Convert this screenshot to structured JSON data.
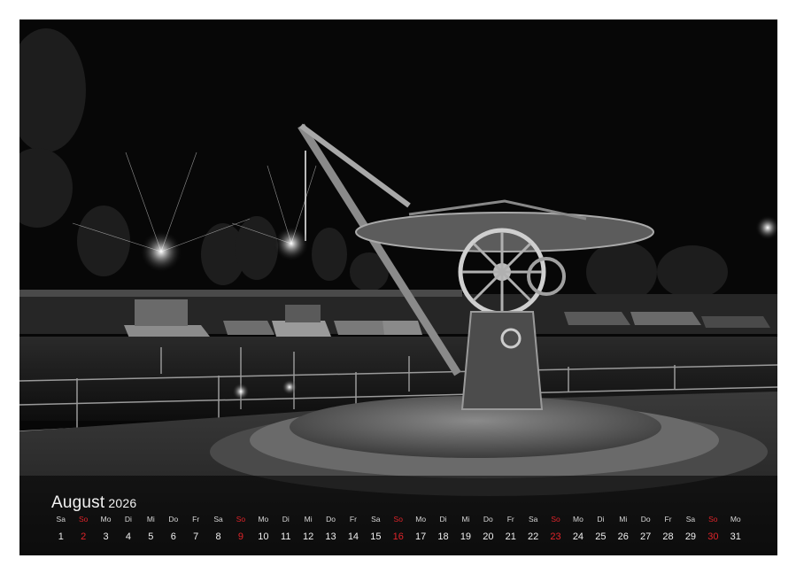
{
  "calendar": {
    "month": "August",
    "year": "2026",
    "days": [
      {
        "dn": "Sa",
        "d": "1",
        "red": false
      },
      {
        "dn": "So",
        "d": "2",
        "red": true
      },
      {
        "dn": "Mo",
        "d": "3",
        "red": false
      },
      {
        "dn": "Di",
        "d": "4",
        "red": false
      },
      {
        "dn": "Mi",
        "d": "5",
        "red": false
      },
      {
        "dn": "Do",
        "d": "6",
        "red": false
      },
      {
        "dn": "Fr",
        "d": "7",
        "red": false
      },
      {
        "dn": "Sa",
        "d": "8",
        "red": false
      },
      {
        "dn": "So",
        "d": "9",
        "red": true
      },
      {
        "dn": "Mo",
        "d": "10",
        "red": false
      },
      {
        "dn": "Di",
        "d": "11",
        "red": false
      },
      {
        "dn": "Mi",
        "d": "12",
        "red": false
      },
      {
        "dn": "Do",
        "d": "13",
        "red": false
      },
      {
        "dn": "Fr",
        "d": "14",
        "red": false
      },
      {
        "dn": "Sa",
        "d": "15",
        "red": false
      },
      {
        "dn": "So",
        "d": "16",
        "red": true
      },
      {
        "dn": "Mo",
        "d": "17",
        "red": false
      },
      {
        "dn": "Di",
        "d": "18",
        "red": false
      },
      {
        "dn": "Mi",
        "d": "19",
        "red": false
      },
      {
        "dn": "Do",
        "d": "20",
        "red": false
      },
      {
        "dn": "Fr",
        "d": "21",
        "red": false
      },
      {
        "dn": "Sa",
        "d": "22",
        "red": false
      },
      {
        "dn": "So",
        "d": "23",
        "red": true
      },
      {
        "dn": "Mo",
        "d": "24",
        "red": false
      },
      {
        "dn": "Di",
        "d": "25",
        "red": false
      },
      {
        "dn": "Mi",
        "d": "26",
        "red": false
      },
      {
        "dn": "Do",
        "d": "27",
        "red": false
      },
      {
        "dn": "Fr",
        "d": "28",
        "red": false
      },
      {
        "dn": "Sa",
        "d": "29",
        "red": false
      },
      {
        "dn": "So",
        "d": "30",
        "red": true
      },
      {
        "dn": "Mo",
        "d": "31",
        "red": false
      }
    ]
  },
  "colors": {
    "sunday_red": "#e0242a",
    "background": "#ffffff",
    "photo_dark": "#0b0b0b"
  },
  "photo": {
    "icon": "harbor-crane-night-photo",
    "tone": "black-and-white"
  }
}
